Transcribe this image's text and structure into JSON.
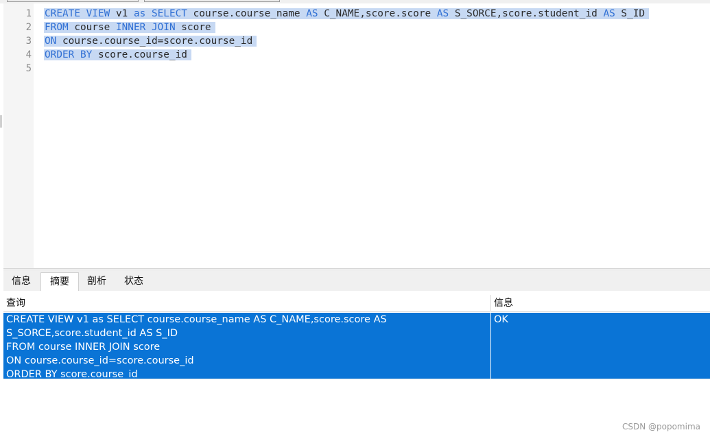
{
  "editor": {
    "line_numbers": [
      "1",
      "2",
      "3",
      "4",
      "5"
    ],
    "lines": [
      [
        {
          "t": "CREATE VIEW",
          "k": true
        },
        {
          "t": " v1 ",
          "k": false
        },
        {
          "t": "as SELECT",
          "k": true
        },
        {
          "t": " course.course_name ",
          "k": false
        },
        {
          "t": "AS",
          "k": true
        },
        {
          "t": " C_NAME,score.score ",
          "k": false
        },
        {
          "t": "AS",
          "k": true
        },
        {
          "t": " S_SORCE,score.student_id ",
          "k": false
        },
        {
          "t": "AS",
          "k": true
        },
        {
          "t": " S_ID",
          "k": false
        }
      ],
      [
        {
          "t": "FROM",
          "k": true
        },
        {
          "t": " course ",
          "k": false
        },
        {
          "t": "INNER JOIN",
          "k": true
        },
        {
          "t": " score",
          "k": false
        }
      ],
      [
        {
          "t": "ON",
          "k": true
        },
        {
          "t": " course.course_id=score.course_id",
          "k": false
        }
      ],
      [
        {
          "t": "ORDER BY",
          "k": true
        },
        {
          "t": " score.course_id",
          "k": false
        }
      ],
      []
    ]
  },
  "tabs": [
    {
      "label": "信息",
      "active": false
    },
    {
      "label": "摘要",
      "active": true
    },
    {
      "label": "剖析",
      "active": false
    },
    {
      "label": "状态",
      "active": false
    }
  ],
  "summary": {
    "columns": {
      "query": "查询",
      "info": "信息"
    },
    "row": {
      "query_lines": [
        "CREATE VIEW v1 as SELECT course.course_name AS C_NAME,score.score AS",
        "S_SORCE,score.student_id AS S_ID",
        "FROM course INNER JOIN score",
        "ON course.course_id=score.course_id",
        "ORDER BY score.course_id"
      ],
      "info": "OK"
    }
  },
  "watermark": "CSDN @popomima",
  "colors": {
    "keyword": "#2f6fd4",
    "selection": "#c7d9f3",
    "row_selected": "#0a74d6"
  }
}
